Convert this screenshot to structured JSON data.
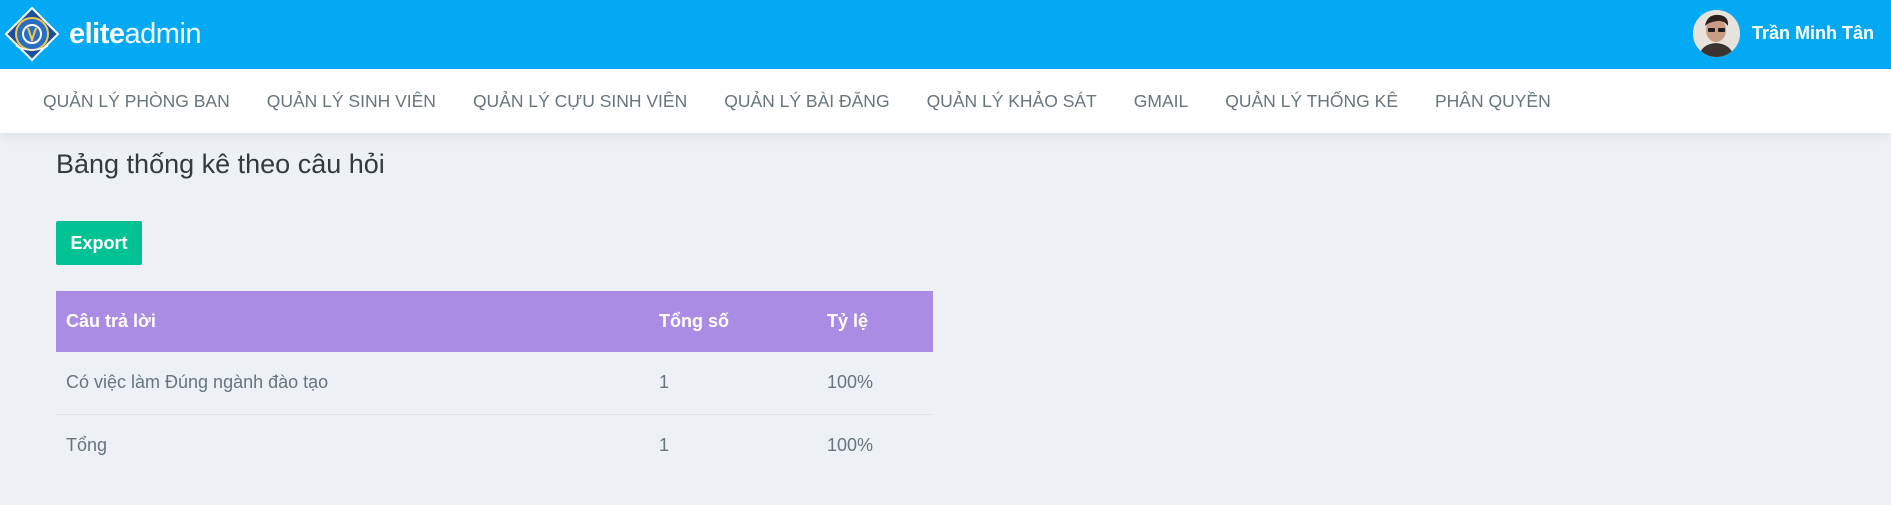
{
  "header": {
    "brand_bold": "elite",
    "brand_light": "admin",
    "logo_icon": "university-seal-icon",
    "avatar_icon": "user-avatar-icon",
    "user_name": "Trần Minh Tân",
    "colors": {
      "topbar": "#03a9f3"
    }
  },
  "nav": {
    "items": [
      {
        "label": "QUẢN LÝ PHÒNG BAN"
      },
      {
        "label": "QUẢN LÝ SINH VIÊN"
      },
      {
        "label": "QUẢN LÝ CỰU SINH VIÊN"
      },
      {
        "label": "QUẢN LÝ BÀI ĐĂNG"
      },
      {
        "label": "QUẢN LÝ KHẢO SÁT"
      },
      {
        "label": "GMAIL"
      },
      {
        "label": "QUẢN LÝ THỐNG KÊ"
      },
      {
        "label": "PHÂN QUYỀN"
      }
    ]
  },
  "main": {
    "title": "Bảng thống kê theo câu hỏi",
    "export_label": "Export",
    "colors": {
      "export_button": "#00c292",
      "table_header": "#ab8ce4"
    },
    "table": {
      "headers": [
        "Câu trả lời",
        "Tổng số",
        "Tỷ lệ"
      ],
      "rows": [
        [
          "Có việc làm Đúng ngành đào tạo",
          "1",
          "100%"
        ],
        [
          "Tổng",
          "1",
          "100%"
        ]
      ]
    }
  }
}
